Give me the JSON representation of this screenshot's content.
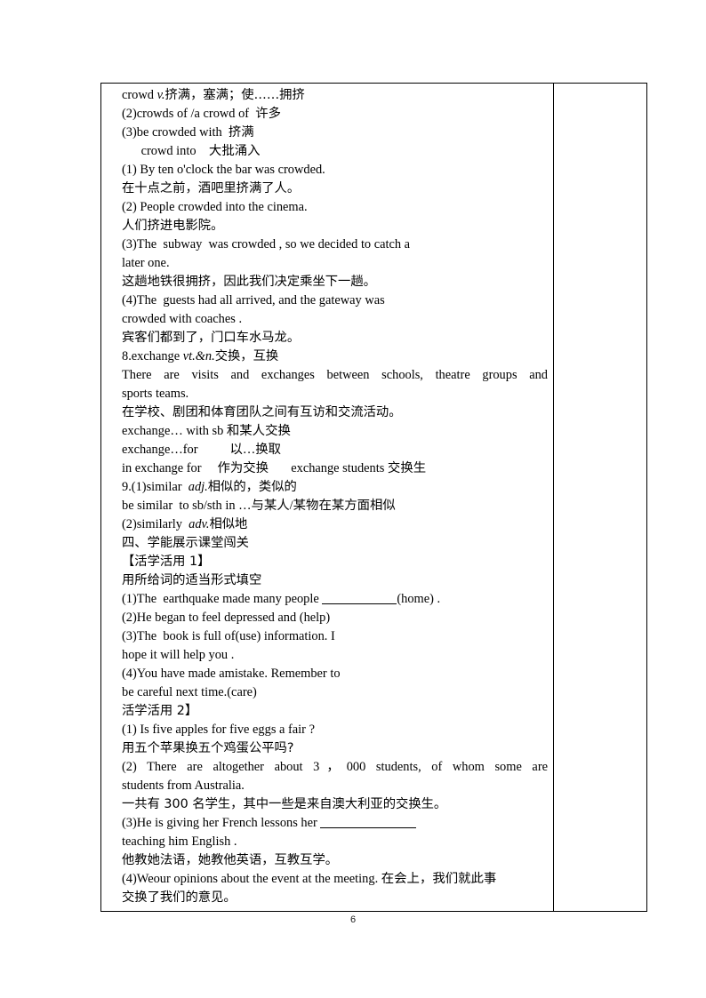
{
  "document": {
    "page_number": "6",
    "table": {
      "columns": 2,
      "main_column_lines": [
        {
          "id": "l01",
          "kind": "mixed",
          "text": "crowd ",
          "italic": "v.",
          "tail": "挤满，塞满；使……拥挤"
        },
        {
          "id": "l02",
          "text": "(2)crowds of /a crowd of  许多"
        },
        {
          "id": "l03",
          "text": "(3)be crowded with  挤满"
        },
        {
          "id": "l04",
          "text": "      crowd into    大批涌入"
        },
        {
          "id": "l05",
          "text": "(1) By ten o'clock the bar was crowded."
        },
        {
          "id": "l06",
          "text": "在十点之前，酒吧里挤满了人。"
        },
        {
          "id": "l07",
          "text": "(2) People crowded into the cinema."
        },
        {
          "id": "l08",
          "text": "人们挤进电影院。"
        },
        {
          "id": "l09",
          "text": "(3)The  subway  was crowded , so we decided to catch a"
        },
        {
          "id": "l10",
          "text": "later one."
        },
        {
          "id": "l11",
          "text": "这趟地铁很拥挤，因此我们决定乘坐下一趟。"
        },
        {
          "id": "l12",
          "text": "(4)The  guests had all arrived, and the gateway was"
        },
        {
          "id": "l13",
          "text": "crowded with coaches ."
        },
        {
          "id": "l14",
          "text": "宾客们都到了，门口车水马龙。"
        },
        {
          "id": "l15",
          "kind": "mixed",
          "text": "8.exchange ",
          "italic": "vt.&n.",
          "tail": "交换，互换"
        },
        {
          "id": "l16",
          "text": "There are visits and exchanges between schools,  theatre groups and"
        },
        {
          "id": "l17",
          "text": "sports teams."
        },
        {
          "id": "l18",
          "text": "在学校、剧团和体育团队之间有互访和交流活动。"
        },
        {
          "id": "l19",
          "text": "exchange… with sb 和某人交换"
        },
        {
          "id": "l20",
          "text": "exchange…for          以…换取"
        },
        {
          "id": "l21",
          "text": "in exchange for     作为交换       exchange students 交换生"
        },
        {
          "id": "l22",
          "kind": "mixed",
          "text": "9.(1)similar  ",
          "italic": "adj.",
          "tail": "相似的，类似的"
        },
        {
          "id": "l23",
          "text": "be similar  to sb/sth in …与某人/某物在某方面相似"
        },
        {
          "id": "l24",
          "kind": "mixed",
          "text": "(2)similarly  ",
          "italic": "adv.",
          "tail": "相似地"
        },
        {
          "id": "l25",
          "text": "四、学能展示课堂闯关"
        },
        {
          "id": "l26",
          "text": "【活学活用 1】"
        },
        {
          "id": "l27",
          "text": "用所给词的适当形式填空"
        },
        {
          "id": "l28",
          "kind": "blank",
          "text": "(1)The  earthquake made many people ",
          "tail": "(home) ."
        },
        {
          "id": "l29",
          "text": "(2)He began to feel depressed and (help)"
        },
        {
          "id": "l30",
          "text": "(3)The  book is full of(use) information. I"
        },
        {
          "id": "l31",
          "text": "hope it will help you ."
        },
        {
          "id": "l32",
          "text": "(4)You have made amistake. Remember to"
        },
        {
          "id": "l33",
          "text": "be careful next time.(care)"
        },
        {
          "id": "l34",
          "text": "活学活用 2】"
        },
        {
          "id": "l35",
          "text": "(1) Is five apples for five eggs a fair ?"
        },
        {
          "id": "l36",
          "text": "用五个苹果换五个鸡蛋公平吗?"
        },
        {
          "id": "l37",
          "text": "(2) There are altogether about 3，000 students, of whom some are"
        },
        {
          "id": "l38",
          "text": "students from Australia."
        },
        {
          "id": "l39",
          "text": "一共有 300 名学生，其中一些是来自澳大利亚的交换生。"
        },
        {
          "id": "l40",
          "kind": "blank2",
          "text": "(3)He is giving her French lessons her ",
          "tail": ""
        },
        {
          "id": "l41",
          "text": "teaching him English ."
        },
        {
          "id": "l42",
          "text": "他教她法语，她教他英语，互教互学。"
        },
        {
          "id": "l43",
          "text": "(4)Weour opinions about the event at the meeting. 在会上，我们就此事"
        },
        {
          "id": "l44",
          "text": "交换了我们的意见。"
        }
      ],
      "side_column_lines": []
    }
  }
}
